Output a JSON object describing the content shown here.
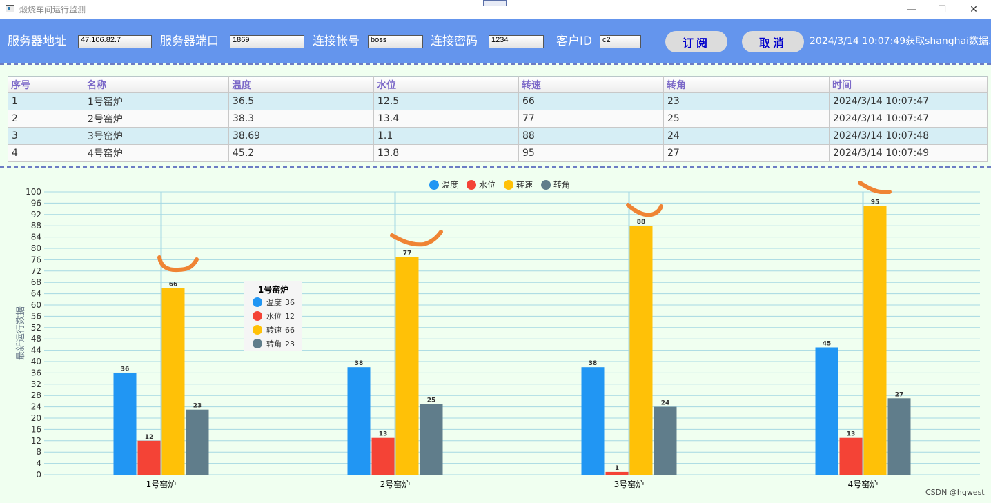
{
  "window": {
    "title": "煅烧车间运行监测",
    "min_glyph": "—",
    "max_glyph": "☐",
    "close_glyph": "✕"
  },
  "toolbar": {
    "server_addr_label": "服务器地址",
    "server_addr_value": "47.106.82.7",
    "server_port_label": "服务器端口",
    "server_port_value": "1869",
    "account_label": "连接帐号",
    "account_value": "boss",
    "password_label": "连接密码",
    "password_value": "1234",
    "client_id_label": "客户ID",
    "client_id_value": "c2",
    "subscribe_label": "订阅",
    "cancel_label": "取消",
    "status": "2024/3/14 10:07:49获取shanghai数据."
  },
  "table": {
    "headers": [
      "序号",
      "名称",
      "温度",
      "水位",
      "转速",
      "转角",
      "时间"
    ],
    "rows": [
      [
        "1",
        "1号窑炉",
        "36.5",
        "12.5",
        "66",
        "23",
        "2024/3/14 10:07:47"
      ],
      [
        "2",
        "2号窑炉",
        "38.3",
        "13.4",
        "77",
        "25",
        "2024/3/14 10:07:47"
      ],
      [
        "3",
        "3号窑炉",
        "38.69",
        "1.1",
        "88",
        "24",
        "2024/3/14 10:07:48"
      ],
      [
        "4",
        "4号窑炉",
        "45.2",
        "13.8",
        "95",
        "27",
        "2024/3/14 10:07:49"
      ]
    ]
  },
  "chart_data": {
    "type": "bar",
    "categories": [
      "1号窑炉",
      "2号窑炉",
      "3号窑炉",
      "4号窑炉"
    ],
    "series": [
      {
        "name": "温度",
        "color": "#2196f3",
        "values": [
          36,
          38,
          38,
          45
        ]
      },
      {
        "name": "水位",
        "color": "#f44336",
        "values": [
          12,
          13,
          1,
          13
        ]
      },
      {
        "name": "转速",
        "color": "#ffc107",
        "values": [
          66,
          77,
          88,
          95
        ]
      },
      {
        "name": "转角",
        "color": "#607d8b",
        "values": [
          23,
          25,
          24,
          27
        ]
      }
    ],
    "ylabel": "最新运行数据",
    "ylim": [
      0,
      100
    ],
    "ytick_step": 4,
    "grid": true,
    "legend": "top-center",
    "tooltip": {
      "title": "1号窑炉",
      "rows": [
        {
          "name": "温度",
          "value": "36"
        },
        {
          "name": "水位",
          "value": "12"
        },
        {
          "name": "转速",
          "value": "66"
        },
        {
          "name": "转角",
          "value": "23"
        }
      ]
    }
  },
  "watermark": "CSDN @hqwest"
}
